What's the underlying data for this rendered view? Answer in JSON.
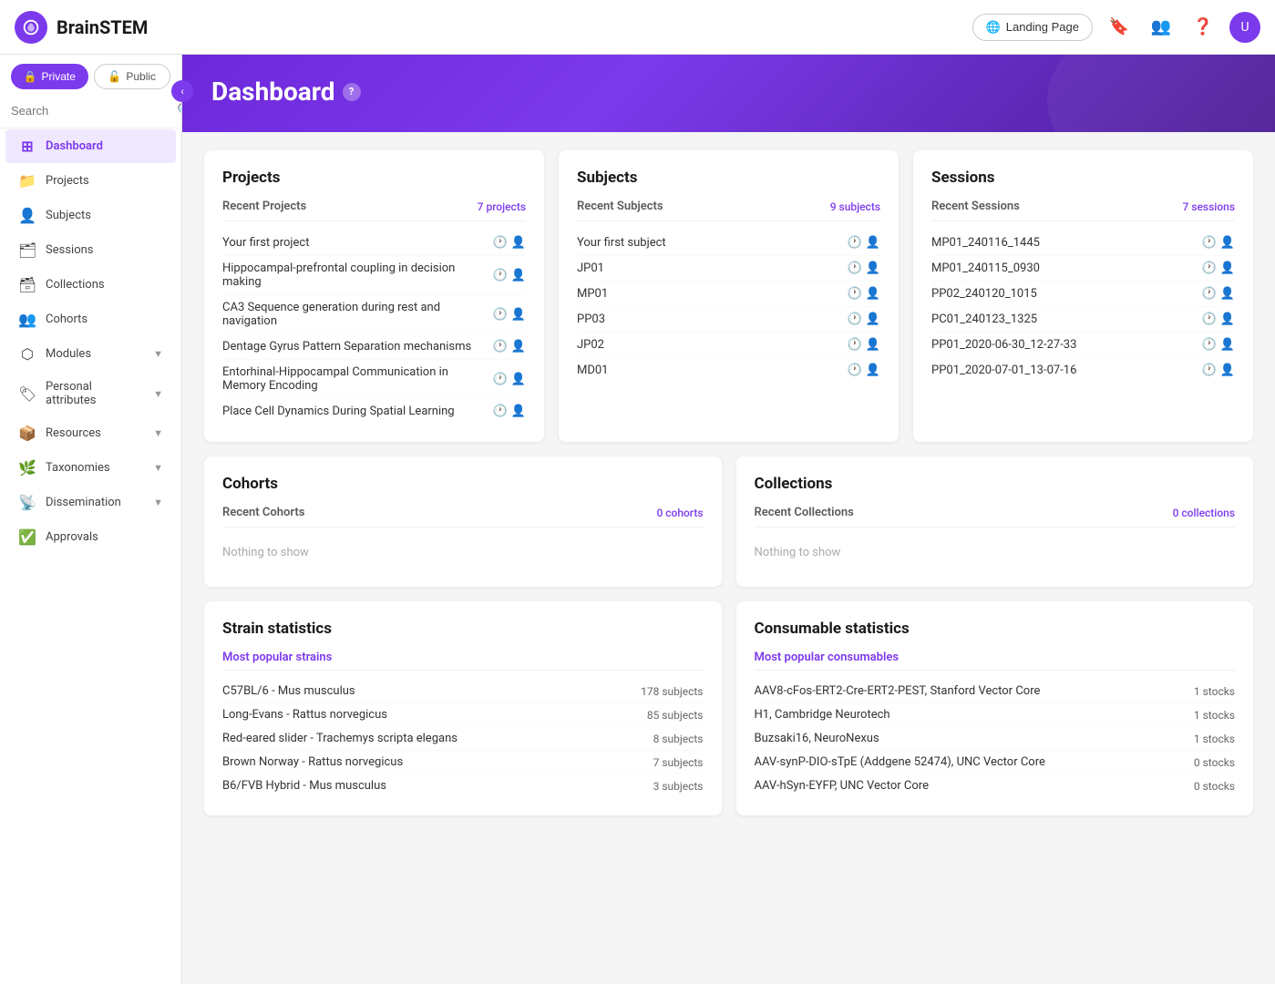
{
  "brand": {
    "name": "BrainSTEM"
  },
  "topnav": {
    "landing_page_label": "Landing Page",
    "bookmark_icon": "🔖",
    "users_icon": "👥",
    "help_icon": "?",
    "avatar_initial": "U"
  },
  "sidebar": {
    "toggle_private": "Private",
    "toggle_public": "Public",
    "search_placeholder": "Search",
    "collapse_icon": "‹",
    "items": [
      {
        "id": "dashboard",
        "label": "Dashboard",
        "icon": "⊞",
        "active": true,
        "hasArrow": false
      },
      {
        "id": "projects",
        "label": "Projects",
        "icon": "📁",
        "active": false,
        "hasArrow": false
      },
      {
        "id": "subjects",
        "label": "Subjects",
        "icon": "👤",
        "active": false,
        "hasArrow": false
      },
      {
        "id": "sessions",
        "label": "Sessions",
        "icon": "🗂",
        "active": false,
        "hasArrow": false
      },
      {
        "id": "collections",
        "label": "Collections",
        "icon": "🗃",
        "active": false,
        "hasArrow": false
      },
      {
        "id": "cohorts",
        "label": "Cohorts",
        "icon": "👥",
        "active": false,
        "hasArrow": false
      },
      {
        "id": "modules",
        "label": "Modules",
        "icon": "⬡",
        "active": false,
        "hasArrow": true
      },
      {
        "id": "personal_attributes",
        "label": "Personal attributes",
        "icon": "🏷",
        "active": false,
        "hasArrow": true
      },
      {
        "id": "resources",
        "label": "Resources",
        "icon": "📦",
        "active": false,
        "hasArrow": true
      },
      {
        "id": "taxonomies",
        "label": "Taxonomies",
        "icon": "🌿",
        "active": false,
        "hasArrow": true
      },
      {
        "id": "dissemination",
        "label": "Dissemination",
        "icon": "📡",
        "active": false,
        "hasArrow": true
      },
      {
        "id": "approvals",
        "label": "Approvals",
        "icon": "✅",
        "active": false,
        "hasArrow": false
      }
    ]
  },
  "dashboard": {
    "title": "Dashboard",
    "help_icon": "?",
    "projects": {
      "title": "Projects",
      "section_title": "Recent Projects",
      "count": "7 projects",
      "items": [
        {
          "name": "Your first project"
        },
        {
          "name": "Hippocampal-prefrontal coupling in decision making"
        },
        {
          "name": "CA3 Sequence generation during rest and navigation"
        },
        {
          "name": "Dentage Gyrus Pattern Separation mechanisms"
        },
        {
          "name": "Entorhinal-Hippocampal Communication in Memory Encoding"
        },
        {
          "name": "Place Cell Dynamics During Spatial Learning"
        }
      ]
    },
    "subjects": {
      "title": "Subjects",
      "section_title": "Recent Subjects",
      "count": "9 subjects",
      "items": [
        {
          "name": "Your first subject"
        },
        {
          "name": "JP01"
        },
        {
          "name": "MP01"
        },
        {
          "name": "PP03"
        },
        {
          "name": "JP02"
        },
        {
          "name": "MD01"
        }
      ]
    },
    "sessions": {
      "title": "Sessions",
      "section_title": "Recent Sessions",
      "count": "7 sessions",
      "items": [
        {
          "name": "MP01_240116_1445"
        },
        {
          "name": "MP01_240115_0930"
        },
        {
          "name": "PP02_240120_1015"
        },
        {
          "name": "PC01_240123_1325"
        },
        {
          "name": "PP01_2020-06-30_12-27-33"
        },
        {
          "name": "PP01_2020-07-01_13-07-16"
        }
      ]
    },
    "cohorts": {
      "title": "Cohorts",
      "section_title": "Recent Cohorts",
      "count": "0 cohorts",
      "empty_message": "Nothing to show"
    },
    "collections": {
      "title": "Collections",
      "section_title": "Recent Collections",
      "count": "0 collections",
      "empty_message": "Nothing to show"
    },
    "strain_statistics": {
      "title": "Strain statistics",
      "section_label": "Most popular strains",
      "items": [
        {
          "name": "C57BL/6 - Mus musculus",
          "value": "178 subjects"
        },
        {
          "name": "Long-Evans - Rattus norvegicus",
          "value": "85 subjects"
        },
        {
          "name": "Red-eared slider - Trachemys scripta elegans",
          "value": "8 subjects"
        },
        {
          "name": "Brown Norway - Rattus norvegicus",
          "value": "7 subjects"
        },
        {
          "name": "B6/FVB Hybrid - Mus musculus",
          "value": "3 subjects"
        }
      ]
    },
    "consumable_statistics": {
      "title": "Consumable statistics",
      "section_label": "Most popular consumables",
      "items": [
        {
          "name": "AAV8-cFos-ERT2-Cre-ERT2-PEST, Stanford Vector Core",
          "value": "1 stocks"
        },
        {
          "name": "H1, Cambridge Neurotech",
          "value": "1 stocks"
        },
        {
          "name": "Buzsaki16, NeuroNexus",
          "value": "1 stocks"
        },
        {
          "name": "AAV-synP-DIO-sTpE (Addgene 52474), UNC Vector Core",
          "value": "0 stocks"
        },
        {
          "name": "AAV-hSyn-EYFP, UNC Vector Core",
          "value": "0 stocks"
        }
      ]
    }
  }
}
